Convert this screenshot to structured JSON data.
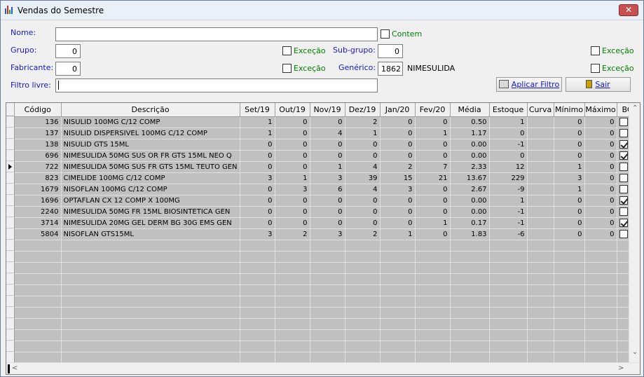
{
  "window": {
    "title": "Vendas do Semestre",
    "close_label": "✕"
  },
  "filters": {
    "nome_label": "Nome:",
    "nome_value": "",
    "contem_label": "Contem",
    "grupo_label": "Grupo:",
    "grupo_value": "0",
    "grupo_excecao": "Exceção",
    "subgrupo_label": "Sub-grupo:",
    "subgrupo_value": "0",
    "subgrupo_excecao": "Exceção",
    "fabricante_label": "Fabricante:",
    "fabricante_value": "0",
    "fabricante_excecao": "Exceção",
    "generico_label": "Genérico:",
    "generico_value": "1862",
    "generico_name": "NIMESULIDA",
    "generico_excecao": "Exceção",
    "filtro_label": "Filtro livre:",
    "filtro_value": ""
  },
  "buttons": {
    "aplicar": "Aplicar Filtro",
    "sair": "Sair"
  },
  "table": {
    "columns": [
      "Código",
      "Descrição",
      "Set/19",
      "Out/19",
      "Nov/19",
      "Dez/19",
      "Jan/20",
      "Fev/20",
      "Média",
      "Estoque",
      "Curva",
      "Mínimo",
      "Máximo",
      "BC"
    ],
    "rows": [
      {
        "codigo": "136",
        "descricao": "NISULID 100MG C/12 COMP",
        "set": "1",
        "out": "0",
        "nov": "0",
        "dez": "2",
        "jan": "0",
        "fev": "0",
        "media": "0.50",
        "estoque": "1",
        "curva": "",
        "minimo": "0",
        "maximo": "0",
        "bc": false
      },
      {
        "codigo": "137",
        "descricao": "NISULID DISPERSIVEL 100MG C/12 COMP",
        "set": "1",
        "out": "0",
        "nov": "4",
        "dez": "1",
        "jan": "0",
        "fev": "1",
        "media": "1.17",
        "estoque": "0",
        "curva": "",
        "minimo": "0",
        "maximo": "0",
        "bc": false
      },
      {
        "codigo": "138",
        "descricao": "NISULID GTS 15ML",
        "set": "0",
        "out": "0",
        "nov": "0",
        "dez": "0",
        "jan": "0",
        "fev": "0",
        "media": "0.00",
        "estoque": "-1",
        "curva": "",
        "minimo": "0",
        "maximo": "0",
        "bc": true
      },
      {
        "codigo": "696",
        "descricao": "NIMESULIDA 50MG SUS OR FR GTS 15ML NEO Q",
        "set": "0",
        "out": "0",
        "nov": "0",
        "dez": "0",
        "jan": "0",
        "fev": "0",
        "media": "0.00",
        "estoque": "0",
        "curva": "",
        "minimo": "0",
        "maximo": "0",
        "bc": true
      },
      {
        "codigo": "722",
        "descricao": "NIMESULIDA 50MG SUS FR GTS 15ML TEUTO GEN",
        "set": "0",
        "out": "0",
        "nov": "1",
        "dez": "4",
        "jan": "2",
        "fev": "7",
        "media": "2.33",
        "estoque": "12",
        "curva": "",
        "minimo": "1",
        "maximo": "0",
        "bc": false
      },
      {
        "codigo": "823",
        "descricao": "CIMELIDE 100MG C/12 COMP",
        "set": "3",
        "out": "1",
        "nov": "3",
        "dez": "39",
        "jan": "15",
        "fev": "21",
        "media": "13.67",
        "estoque": "229",
        "curva": "",
        "minimo": "3",
        "maximo": "0",
        "bc": false
      },
      {
        "codigo": "1679",
        "descricao": "NISOFLAN 100MG C/12 COMP",
        "set": "0",
        "out": "3",
        "nov": "6",
        "dez": "4",
        "jan": "3",
        "fev": "0",
        "media": "2.67",
        "estoque": "-9",
        "curva": "",
        "minimo": "1",
        "maximo": "0",
        "bc": false
      },
      {
        "codigo": "1696",
        "descricao": "OPTAFLAN CX 12 COMP X 100MG",
        "set": "0",
        "out": "0",
        "nov": "0",
        "dez": "0",
        "jan": "0",
        "fev": "0",
        "media": "0.00",
        "estoque": "1",
        "curva": "",
        "minimo": "0",
        "maximo": "0",
        "bc": true
      },
      {
        "codigo": "2240",
        "descricao": "NIMESULIDA 50MG FR 15ML BIOSINTETICA GEN",
        "set": "0",
        "out": "0",
        "nov": "0",
        "dez": "0",
        "jan": "0",
        "fev": "0",
        "media": "0.00",
        "estoque": "-1",
        "curva": "",
        "minimo": "0",
        "maximo": "0",
        "bc": false
      },
      {
        "codigo": "3714",
        "descricao": "NIMESULIDA 20MG GEL DERM BG 30G EMS GEN",
        "set": "0",
        "out": "0",
        "nov": "0",
        "dez": "0",
        "jan": "0",
        "fev": "1",
        "media": "0.17",
        "estoque": "-1",
        "curva": "",
        "minimo": "0",
        "maximo": "0",
        "bc": true
      },
      {
        "codigo": "5804",
        "descricao": "NISOFLAN GTS15ML",
        "set": "3",
        "out": "2",
        "nov": "3",
        "dez": "2",
        "jan": "1",
        "fev": "0",
        "media": "1.83",
        "estoque": "-6",
        "curva": "",
        "minimo": "0",
        "maximo": "0",
        "bc": false
      }
    ],
    "current_row": 4
  },
  "scroll": {
    "up": "⌃",
    "down": "⌄",
    "left": "<",
    "right": ">"
  }
}
